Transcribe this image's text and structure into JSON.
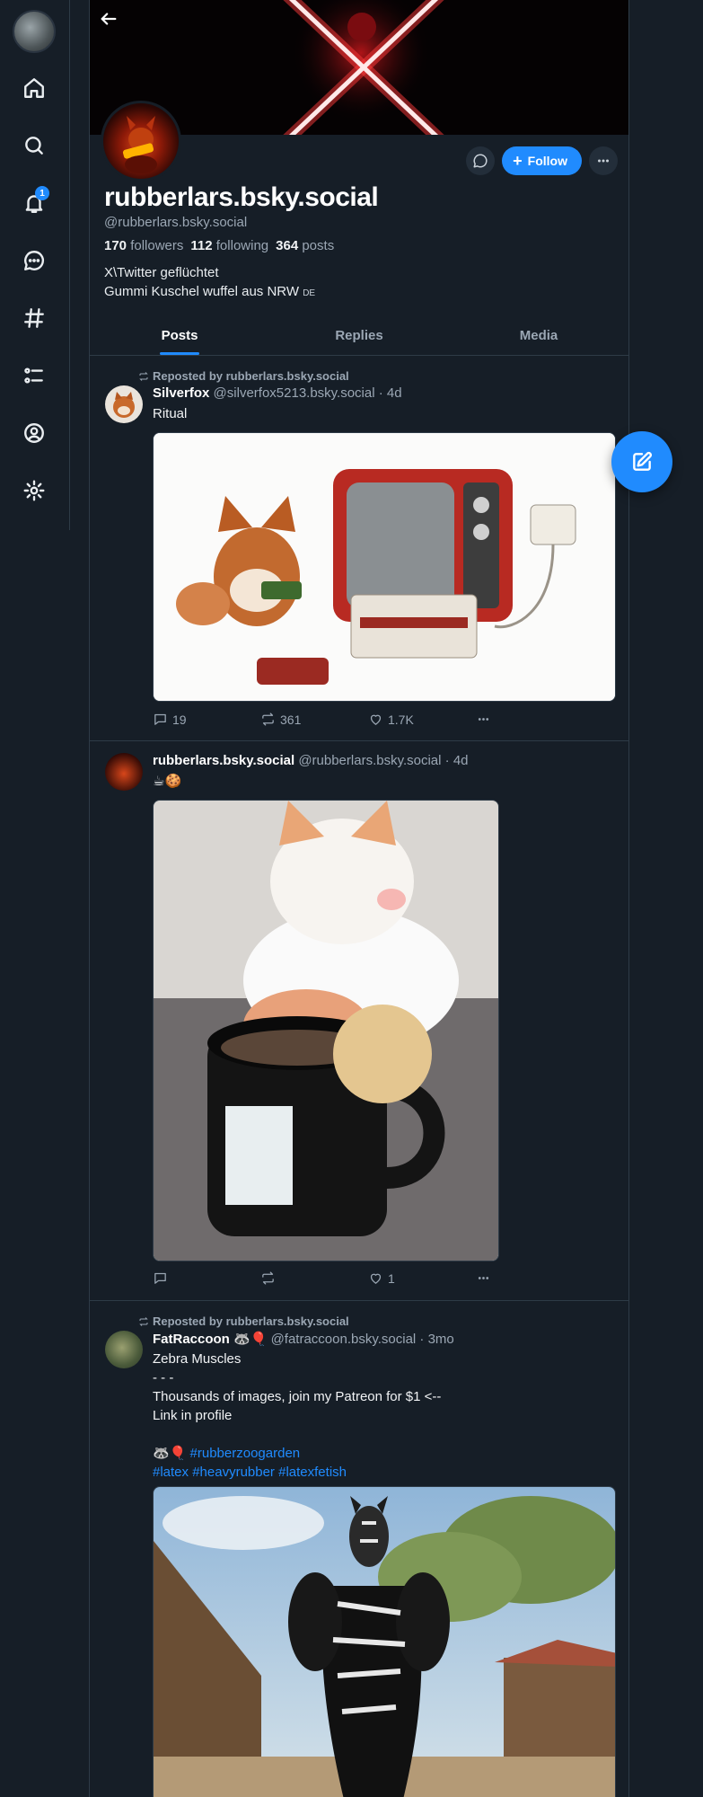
{
  "nav": {
    "items": [
      {
        "name": "home-icon"
      },
      {
        "name": "search-icon"
      },
      {
        "name": "bell-icon",
        "badge": "1"
      },
      {
        "name": "chat-icon"
      },
      {
        "name": "hashtag-icon"
      },
      {
        "name": "list-icon"
      },
      {
        "name": "profile-icon"
      },
      {
        "name": "gear-icon"
      }
    ]
  },
  "profile": {
    "display_name": "rubberlars.bsky.social",
    "handle": "@rubberlars.bsky.social",
    "followers_count": "170",
    "followers_label": "followers",
    "following_count": "112",
    "following_label": "following",
    "posts_count": "364",
    "posts_label": "posts",
    "bio_line1": "X\\Twitter geflüchtet",
    "bio_line2": "Gummi Kuschel wuffel aus NRW",
    "bio_flag": "DE",
    "follow_label": "Follow"
  },
  "tabs": [
    {
      "label": "Posts",
      "active": true
    },
    {
      "label": "Replies",
      "active": false
    },
    {
      "label": "Media",
      "active": false
    }
  ],
  "posts": [
    {
      "repost_label": "Reposted by rubberlars.bsky.social",
      "author": "Silverfox",
      "author_handle": "@silverfox5213.bsky.social · 4d",
      "text": "Ritual",
      "replies": "19",
      "reposts": "361",
      "likes": "1.7K"
    },
    {
      "author": "rubberlars.bsky.social",
      "author_handle": "@rubberlars.bsky.social · 4d",
      "text": "☕🍪",
      "replies": "",
      "reposts": "",
      "likes": "1"
    },
    {
      "repost_label": "Reposted by rubberlars.bsky.social",
      "author": "FatRaccoon",
      "author_emoji": "🦝🎈",
      "author_handle": "@fatraccoon.bsky.social · 3mo",
      "line1": "Zebra Muscles",
      "line2": "- - -",
      "line3": "Thousands of images, join my Patreon for $1 <--",
      "line4": "Link in profile",
      "line5_emoji": "🦝🎈",
      "hashtag1": "#rubberzoogarden",
      "hashtag2": "#latex",
      "hashtag3": "#heavyrubber",
      "hashtag4": "#latexfetish"
    }
  ],
  "colors": {
    "accent": "#208bfe",
    "background": "#161e27",
    "border": "#2e3b47",
    "muted": "#9ba7b4"
  }
}
